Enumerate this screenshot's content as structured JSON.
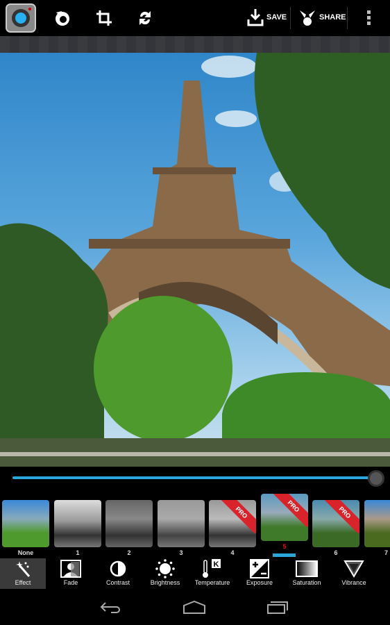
{
  "toolbar": {
    "save_label": "SAVE",
    "share_label": "SHARE",
    "icons": [
      "app-logo-icon",
      "rotate-icon",
      "crop-icon",
      "flip-icon",
      "save-icon",
      "share-icon",
      "overflow-menu-icon"
    ]
  },
  "adjustment": {
    "slider_value_percent": 100,
    "accent": "#2aa7d8"
  },
  "filters": [
    {
      "label": "None",
      "pro": false
    },
    {
      "label": "1",
      "pro": false
    },
    {
      "label": "2",
      "pro": false
    },
    {
      "label": "3",
      "pro": false
    },
    {
      "label": "4",
      "pro": true
    },
    {
      "label": "5",
      "pro": true,
      "selected": true
    },
    {
      "label": "6",
      "pro": true
    },
    {
      "label": "7",
      "pro": false
    }
  ],
  "pro_badge": "PRO",
  "tools": [
    {
      "label": "Effect",
      "active": true
    },
    {
      "label": "Fade"
    },
    {
      "label": "Contrast"
    },
    {
      "label": "Brightness"
    },
    {
      "label": "Temperature"
    },
    {
      "label": "Exposure"
    },
    {
      "label": "Saturation"
    },
    {
      "label": "Vibrance"
    }
  ],
  "temperature_badge": "K"
}
